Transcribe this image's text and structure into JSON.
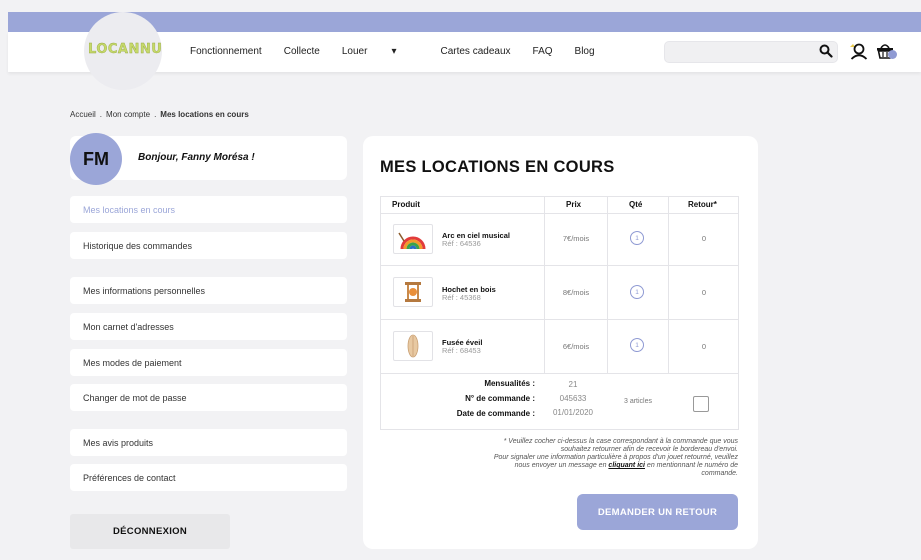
{
  "brand": {
    "logo_text": "LOCANNU"
  },
  "nav": {
    "links": [
      {
        "label": "Fonctionnement"
      },
      {
        "label": "Collecte"
      },
      {
        "label": "Louer",
        "caret": "▾"
      },
      {
        "label": "Cartes cadeaux"
      },
      {
        "label": "FAQ"
      },
      {
        "label": "Blog"
      }
    ],
    "search": {
      "value": "",
      "placeholder": ""
    }
  },
  "breadcrumb": {
    "items": [
      "Accueil",
      "Mon compte",
      "Mes locations en cours"
    ],
    "separator": "."
  },
  "profile": {
    "initials": "FM",
    "greeting": "Bonjour, Fanny Morésa !"
  },
  "sidebar": {
    "items": [
      {
        "label": "Mes locations en cours",
        "active": true
      },
      {
        "label": "Historique des commandes"
      },
      {
        "label": "Mes informations personnelles"
      },
      {
        "label": "Mon carnet d'adresses"
      },
      {
        "label": "Mes modes de paiement"
      },
      {
        "label": "Changer de mot de passe"
      },
      {
        "label": "Mes avis produits"
      },
      {
        "label": "Préférences de contact"
      }
    ],
    "logout_label": "DÉCONNEXION"
  },
  "main": {
    "title": "MES LOCATIONS EN COURS",
    "table": {
      "headers": [
        "Produit",
        "Prix",
        "Qté",
        "Retour*"
      ],
      "rows": [
        {
          "name": "Arc en ciel musical",
          "ref": "Réf : 64536",
          "price": "7€/mois",
          "qty": "1",
          "ret": "0",
          "thumb": "rainbow"
        },
        {
          "name": "Hochet en bois",
          "ref": "Réf : 45368",
          "price": "8€/mois",
          "qty": "1",
          "ret": "0",
          "thumb": "rattle"
        },
        {
          "name": "Fusée éveil",
          "ref": "Réf : 68453",
          "price": "6€/mois",
          "qty": "1",
          "ret": "0",
          "thumb": "rocket"
        }
      ],
      "summary": [
        {
          "label": "Mensualités :",
          "value": "21"
        },
        {
          "label": "N° de commande :",
          "value": "045633"
        },
        {
          "label": "Date de commande :",
          "value": "01/01/2020"
        }
      ],
      "articles": "3 articles"
    },
    "note": {
      "line1": "* Veuillez cocher ci-dessus la case correspondant à la commande que vous",
      "line2": "souhaitez retourner afin de recevoir le bordereau d'envoi.",
      "line3": "Pour signaler une information particulière à propos d'un jouet retourné, veuillez",
      "line4_pre": "nous envoyer un message en ",
      "line4_link": "cliquant ici",
      "line4_post": " en mentionnant le numéro de",
      "line5": "commande."
    },
    "return_button": "DEMANDER UN RETOUR"
  },
  "colors": {
    "accent": "#9ba6d8",
    "logo": "#c6d96a",
    "background": "#f2f2f4"
  }
}
